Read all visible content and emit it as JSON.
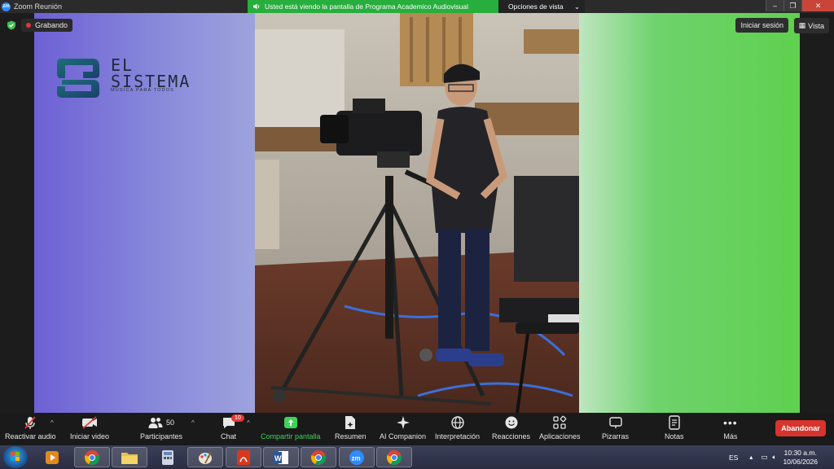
{
  "window": {
    "title": "Zoom Reunión",
    "app_icon": "zoom-icon"
  },
  "share_banner": {
    "text": "Usted está viendo la pantalla de Programa Academico Audiovisual",
    "view_options": "Opciones de vista"
  },
  "status": {
    "recording": "Grabando"
  },
  "header_buttons": {
    "signin": "Iniciar sesión",
    "view": "Vista"
  },
  "logo": {
    "line1": "EL",
    "line2": "SISTEMA",
    "tagline": "MÚSICA PARA TODOS"
  },
  "toolbar": {
    "unmute": "Reactivar audio",
    "start_video": "Iniciar video",
    "participants": "Participantes",
    "participants_count": "50",
    "chat": "Chat",
    "chat_badge": "10",
    "share": "Compartir pantalla",
    "summary": "Resumen",
    "ai_companion": "AI Companion",
    "interpretation": "Interpretación",
    "reactions": "Reacciones",
    "apps": "Aplicaciones",
    "whiteboards": "Pizarras",
    "notes": "Notas",
    "more": "Más",
    "leave": "Abandonar"
  },
  "taskbar": {
    "lang": "ES",
    "time": "10:30 a.m.",
    "date": "10/06/2026"
  },
  "colors": {
    "share_green": "#27ae3c",
    "leave_red": "#d6342c",
    "record_red": "#e53935"
  }
}
